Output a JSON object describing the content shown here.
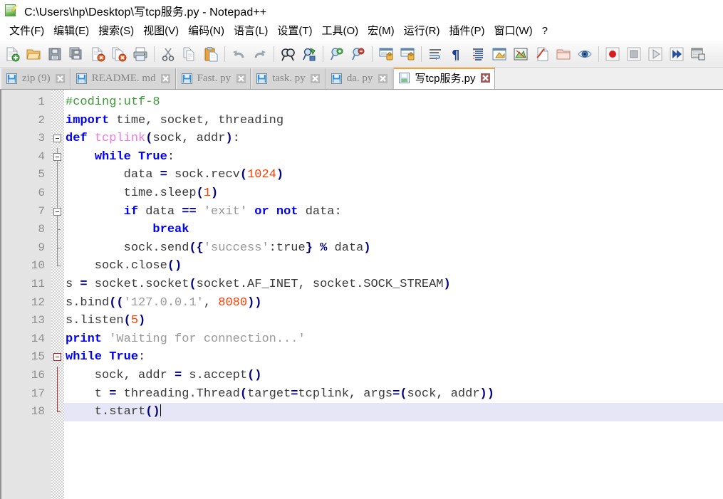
{
  "window": {
    "icon": "notepadpp-icon",
    "title": "C:\\Users\\hp\\Desktop\\写tcp服务.py - Notepad++"
  },
  "menubar": {
    "items": [
      {
        "label": "文件(F)",
        "name": "menu-file"
      },
      {
        "label": "编辑(E)",
        "name": "menu-edit"
      },
      {
        "label": "搜索(S)",
        "name": "menu-search"
      },
      {
        "label": "视图(V)",
        "name": "menu-view"
      },
      {
        "label": "编码(N)",
        "name": "menu-encoding"
      },
      {
        "label": "语言(L)",
        "name": "menu-language"
      },
      {
        "label": "设置(T)",
        "name": "menu-settings"
      },
      {
        "label": "工具(O)",
        "name": "menu-tools"
      },
      {
        "label": "宏(M)",
        "name": "menu-macro"
      },
      {
        "label": "运行(R)",
        "name": "menu-run"
      },
      {
        "label": "插件(P)",
        "name": "menu-plugins"
      },
      {
        "label": "窗口(W)",
        "name": "menu-window"
      },
      {
        "label": "?",
        "name": "menu-help"
      }
    ]
  },
  "toolbar": {
    "buttons": [
      {
        "name": "new-file-icon",
        "tip": "新建"
      },
      {
        "name": "open-file-icon",
        "tip": "打开"
      },
      {
        "name": "save-icon",
        "tip": "保存"
      },
      {
        "name": "save-all-icon",
        "tip": "保存所有"
      },
      {
        "name": "close-file-icon",
        "tip": "关闭"
      },
      {
        "name": "close-all-files-icon",
        "tip": "关闭所有"
      },
      {
        "name": "print-icon",
        "tip": "打印"
      },
      {
        "name": "separator-1"
      },
      {
        "name": "cut-icon",
        "tip": "剪切"
      },
      {
        "name": "copy-icon",
        "tip": "复制"
      },
      {
        "name": "paste-icon",
        "tip": "粘贴"
      },
      {
        "name": "separator-2"
      },
      {
        "name": "undo-icon",
        "tip": "撤销"
      },
      {
        "name": "redo-icon",
        "tip": "重做"
      },
      {
        "name": "separator-3"
      },
      {
        "name": "find-icon",
        "tip": "查找"
      },
      {
        "name": "replace-icon",
        "tip": "替换"
      },
      {
        "name": "separator-4"
      },
      {
        "name": "zoom-in-icon",
        "tip": "放大"
      },
      {
        "name": "zoom-out-icon",
        "tip": "缩小"
      },
      {
        "name": "separator-5"
      },
      {
        "name": "sync-vertical-scroll-icon",
        "tip": "同步垂直滚动"
      },
      {
        "name": "sync-horizontal-scroll-icon",
        "tip": "同步水平滚动"
      },
      {
        "name": "separator-6"
      },
      {
        "name": "word-wrap-icon",
        "tip": "自动换行"
      },
      {
        "name": "show-all-characters-icon",
        "tip": "显示所有字符"
      },
      {
        "name": "indent-guide-icon",
        "tip": "显示缩进参考线"
      },
      {
        "name": "user-defined-language-icon",
        "tip": "用户自定义语言"
      },
      {
        "name": "document-map-icon",
        "tip": "文档地图"
      },
      {
        "name": "function-list-icon",
        "tip": "函数列表"
      },
      {
        "name": "folder-as-workspace-icon",
        "tip": "文件夹作为工作区"
      },
      {
        "name": "preview-icon",
        "tip": "预览"
      },
      {
        "name": "separator-7"
      },
      {
        "name": "record-macro-icon",
        "tip": "开始录制"
      },
      {
        "name": "stop-macro-icon",
        "tip": "停止录制"
      },
      {
        "name": "play-macro-icon",
        "tip": "播放"
      },
      {
        "name": "run-macro-multiple-icon",
        "tip": "多次运行宏"
      },
      {
        "name": "save-macro-icon",
        "tip": "保存当前录制的宏"
      }
    ]
  },
  "tabs": [
    {
      "label": "zip  (9)",
      "active": false,
      "name": "tab-zip"
    },
    {
      "label": "README. md",
      "active": false,
      "name": "tab-readme-md"
    },
    {
      "label": "Fast. py",
      "active": false,
      "name": "tab-fast-py"
    },
    {
      "label": "task. py",
      "active": false,
      "name": "tab-task-py"
    },
    {
      "label": "da. py",
      "active": false,
      "name": "tab-da-py"
    },
    {
      "label": "写tcp服务.py",
      "active": true,
      "name": "tab-xie-tcp-fuwu-py"
    }
  ],
  "editor": {
    "current_line": 18,
    "line_numbers": [
      1,
      2,
      3,
      4,
      5,
      6,
      7,
      8,
      9,
      10,
      11,
      12,
      13,
      14,
      15,
      16,
      17,
      18
    ],
    "lines": [
      {
        "n": 1,
        "text": "#coding:utf-8"
      },
      {
        "n": 2,
        "text": "import time, socket, threading"
      },
      {
        "n": 3,
        "text": "def tcplink(sock, addr):"
      },
      {
        "n": 4,
        "text": "    while True:"
      },
      {
        "n": 5,
        "text": "        data = sock.recv(1024)"
      },
      {
        "n": 6,
        "text": "        time.sleep(1)"
      },
      {
        "n": 7,
        "text": "        if data == 'exit' or not data:"
      },
      {
        "n": 8,
        "text": "            break"
      },
      {
        "n": 9,
        "text": "        sock.send({'success':true} % data)"
      },
      {
        "n": 10,
        "text": "    sock.close()"
      },
      {
        "n": 11,
        "text": "s = socket.socket(socket.AF_INET, socket.SOCK_STREAM)"
      },
      {
        "n": 12,
        "text": "s.bind(('127.0.0.1', 8080))"
      },
      {
        "n": 13,
        "text": "s.listen(5)"
      },
      {
        "n": 14,
        "text": "print 'Waiting for connection...'"
      },
      {
        "n": 15,
        "text": "while True:"
      },
      {
        "n": 16,
        "text": "    sock, addr = s.accept()"
      },
      {
        "n": 17,
        "text": "    t = threading.Thread(target=tcplink, args=(sock, addr))"
      },
      {
        "n": 18,
        "text": "    t.start()"
      }
    ],
    "tokens": [
      [
        [
          "#coding:utf-8",
          "com"
        ]
      ],
      [
        [
          "import",
          "kw"
        ],
        [
          " time, socket, threading",
          "def"
        ]
      ],
      [
        [
          "def",
          "kw"
        ],
        [
          " ",
          "def"
        ],
        [
          "tcplink",
          "fn"
        ],
        [
          "(",
          "op"
        ],
        [
          "sock, addr",
          "def"
        ],
        [
          ")",
          "op"
        ],
        [
          ":",
          "def"
        ]
      ],
      [
        [
          "    ",
          "def"
        ],
        [
          "while",
          "kw"
        ],
        [
          " ",
          "def"
        ],
        [
          "True",
          "kw"
        ],
        [
          ":",
          "def"
        ]
      ],
      [
        [
          "        data ",
          "def"
        ],
        [
          "=",
          "op"
        ],
        [
          " sock.recv",
          "def"
        ],
        [
          "(",
          "op"
        ],
        [
          "1024",
          "num"
        ],
        [
          ")",
          "op"
        ]
      ],
      [
        [
          "        time.sleep",
          "def"
        ],
        [
          "(",
          "op"
        ],
        [
          "1",
          "num"
        ],
        [
          ")",
          "op"
        ]
      ],
      [
        [
          "        ",
          "def"
        ],
        [
          "if",
          "kw"
        ],
        [
          " data ",
          "def"
        ],
        [
          "==",
          "op"
        ],
        [
          " ",
          "def"
        ],
        [
          "'exit'",
          "str"
        ],
        [
          " ",
          "def"
        ],
        [
          "or",
          "kw"
        ],
        [
          " ",
          "def"
        ],
        [
          "not",
          "kw"
        ],
        [
          " data:",
          "def"
        ]
      ],
      [
        [
          "            ",
          "def"
        ],
        [
          "break",
          "kw"
        ]
      ],
      [
        [
          "        sock.send",
          "def"
        ],
        [
          "({",
          "op"
        ],
        [
          "'success'",
          "str"
        ],
        [
          ":true",
          "def"
        ],
        [
          "}",
          "op"
        ],
        [
          " ",
          "def"
        ],
        [
          "%",
          "op"
        ],
        [
          " data",
          "def"
        ],
        [
          ")",
          "op"
        ]
      ],
      [
        [
          "    sock.close",
          "def"
        ],
        [
          "()",
          "op"
        ]
      ],
      [
        [
          "s ",
          "def"
        ],
        [
          "=",
          "op"
        ],
        [
          " socket.socket",
          "def"
        ],
        [
          "(",
          "op"
        ],
        [
          "socket.AF_INET, socket.SOCK_STREAM",
          "def"
        ],
        [
          ")",
          "op"
        ]
      ],
      [
        [
          "s.bind",
          "def"
        ],
        [
          "((",
          "op"
        ],
        [
          "'127.0.0.1'",
          "str"
        ],
        [
          ", ",
          "def"
        ],
        [
          "8080",
          "num"
        ],
        [
          "))",
          "op"
        ]
      ],
      [
        [
          "s.listen",
          "def"
        ],
        [
          "(",
          "op"
        ],
        [
          "5",
          "num"
        ],
        [
          ")",
          "op"
        ]
      ],
      [
        [
          "print",
          "kw"
        ],
        [
          " ",
          "def"
        ],
        [
          "'Waiting for connection...'",
          "str"
        ]
      ],
      [
        [
          "while",
          "kw"
        ],
        [
          " ",
          "def"
        ],
        [
          "True",
          "kw"
        ],
        [
          ":",
          "def"
        ]
      ],
      [
        [
          "    sock, addr ",
          "def"
        ],
        [
          "=",
          "op"
        ],
        [
          " s.accept",
          "def"
        ],
        [
          "()",
          "op"
        ]
      ],
      [
        [
          "    t ",
          "def"
        ],
        [
          "=",
          "op"
        ],
        [
          " threading.Thread",
          "def"
        ],
        [
          "(",
          "op"
        ],
        [
          "target",
          "def"
        ],
        [
          "=",
          "op"
        ],
        [
          "tcplink, args",
          "def"
        ],
        [
          "=",
          "op"
        ],
        [
          "(",
          "op"
        ],
        [
          "sock, addr",
          "def"
        ],
        [
          "))",
          "op"
        ]
      ],
      [
        [
          "    t.start",
          "def"
        ],
        [
          "()",
          "op"
        ]
      ]
    ],
    "fold_markers": [
      {
        "line": 3,
        "type": "box"
      },
      {
        "line": 4,
        "type": "box-indent"
      },
      {
        "line": 5,
        "type": "line"
      },
      {
        "line": 6,
        "type": "line"
      },
      {
        "line": 7,
        "type": "box-indent"
      },
      {
        "line": 8,
        "type": "tick"
      },
      {
        "line": 9,
        "type": "tick"
      },
      {
        "line": 10,
        "type": "end"
      },
      {
        "line": 15,
        "type": "box-red"
      },
      {
        "line": 16,
        "type": "line-red"
      },
      {
        "line": 17,
        "type": "line-red"
      },
      {
        "line": 18,
        "type": "end-red"
      }
    ]
  },
  "colors": {
    "accent_tab": "#f2a33a",
    "comment": "#3a9b35",
    "keyword": "#0000ff",
    "function": "#ee77dd",
    "operator": "#000080",
    "number": "#ff4000",
    "string": "#999999",
    "default_text": "#3a3a3a",
    "current_line_bg": "#e6e6f7",
    "linenum_bg": "#e4e4e4",
    "linenum_fg": "#8e8e8e"
  }
}
